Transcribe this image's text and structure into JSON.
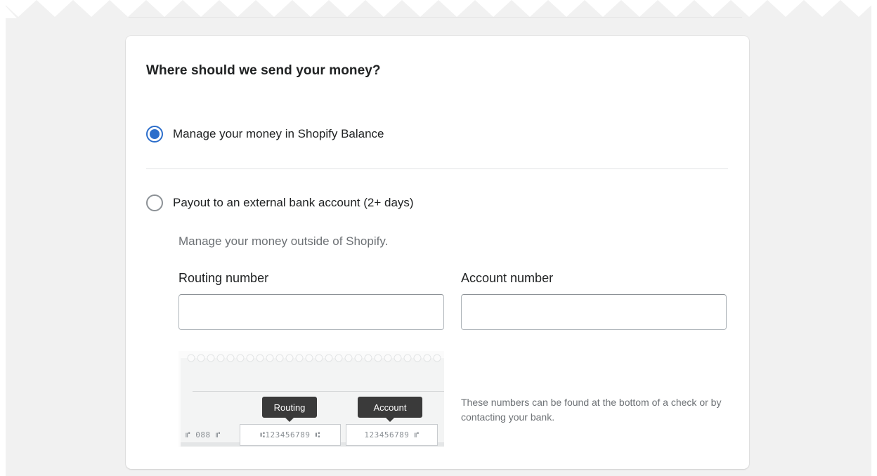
{
  "payout": {
    "title": "Where should we send your money?",
    "options": [
      {
        "label": "Manage your money in Shopify Balance",
        "selected": true
      },
      {
        "label": "Payout to an external bank account (2+ days)",
        "selected": false
      }
    ],
    "external_description": "Manage your money outside of Shopify.",
    "routing": {
      "label": "Routing number",
      "value": "",
      "placeholder": ""
    },
    "account": {
      "label": "Account number",
      "value": "",
      "placeholder": ""
    },
    "check_illustration": {
      "routing_tag": "Routing",
      "account_tag": "Account",
      "check_number": "⑈ 088 ⑈",
      "routing_micr": "⑆123456789 ⑆",
      "account_micr": "123456789 ⑈"
    },
    "check_hint": "These numbers can be found at the bottom of a check or by contacting your bank."
  },
  "colors": {
    "accent": "#2c6ecb",
    "page_background": "#f1f1f1",
    "card_background": "#ffffff",
    "text": "#202223",
    "subdued_text": "#6d7175"
  },
  "icons": {
    "radio_selected": "radio-checked-icon",
    "radio_unselected": "radio-unchecked-icon"
  }
}
